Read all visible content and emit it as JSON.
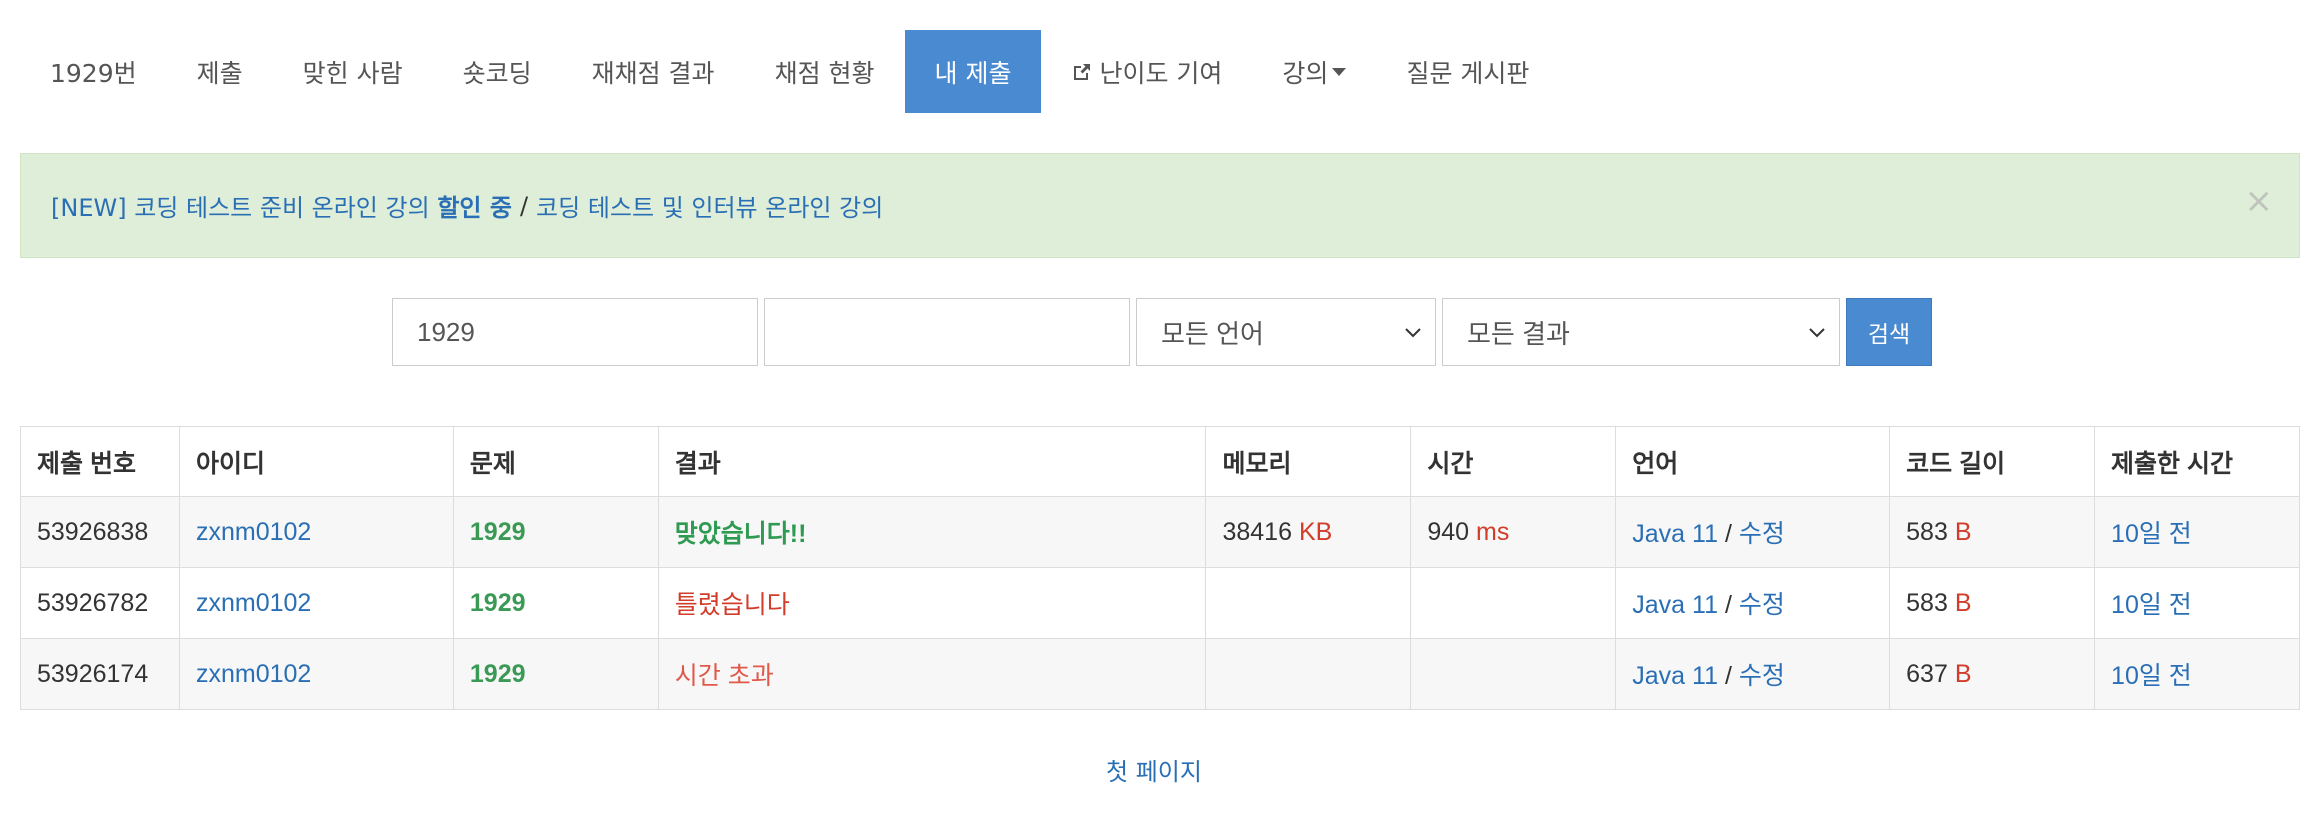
{
  "nav": {
    "items": [
      {
        "label": "1929번",
        "active": false
      },
      {
        "label": "제출",
        "active": false
      },
      {
        "label": "맞힌 사람",
        "active": false
      },
      {
        "label": "숏코딩",
        "active": false
      },
      {
        "label": "재채점 결과",
        "active": false
      },
      {
        "label": "채점 현황",
        "active": false
      },
      {
        "label": "내 제출",
        "active": true
      },
      {
        "label": "난이도 기여",
        "active": false,
        "icon": "external-link-icon"
      },
      {
        "label": "강의",
        "active": false,
        "icon": "caret-down-icon"
      },
      {
        "label": "질문 게시판",
        "active": false
      }
    ]
  },
  "alert": {
    "part1": "[NEW] 코딩 테스트 준비 온라인 강의",
    "part1_bold": "할인 중",
    "separator": "/",
    "part2": "코딩 테스트 및 인터뷰 온라인 강의",
    "close": "×"
  },
  "search": {
    "problem_value": "1929",
    "user_value": "",
    "language_selected": "모든 언어",
    "result_selected": "모든 결과",
    "button_label": "검색"
  },
  "table": {
    "headers": [
      "제출 번호",
      "아이디",
      "문제",
      "결과",
      "메모리",
      "시간",
      "언어",
      "코드 길이",
      "제출한 시간"
    ],
    "rows": [
      {
        "id": "53926838",
        "user": "zxnm0102",
        "problem": "1929",
        "result": "맞았습니다!!",
        "memory": "38416",
        "memory_unit": "KB",
        "time": "940",
        "time_unit": "ms",
        "language": "Java 11",
        "edit": "수정",
        "code_len": "583",
        "code_unit": "B",
        "submitted": "10일 전"
      },
      {
        "id": "53926782",
        "user": "zxnm0102",
        "problem": "1929",
        "result": "틀렸습니다",
        "memory": "",
        "memory_unit": "",
        "time": "",
        "time_unit": "",
        "language": "Java 11",
        "edit": "수정",
        "code_len": "583",
        "code_unit": "B",
        "submitted": "10일 전"
      },
      {
        "id": "53926174",
        "user": "zxnm0102",
        "problem": "1929",
        "result": "시간 초과",
        "memory": "",
        "memory_unit": "",
        "time": "",
        "time_unit": "",
        "language": "Java 11",
        "edit": "수정",
        "code_len": "637",
        "code_unit": "B",
        "submitted": "10일 전"
      }
    ]
  },
  "pager": {
    "first_page": "첫 페이지"
  },
  "colors": {
    "accent": "#4a8ad1",
    "link": "#2a6fb5",
    "accepted": "#2f9a52",
    "wrong": "#d23c2a",
    "alert_bg": "#dfeed8"
  }
}
